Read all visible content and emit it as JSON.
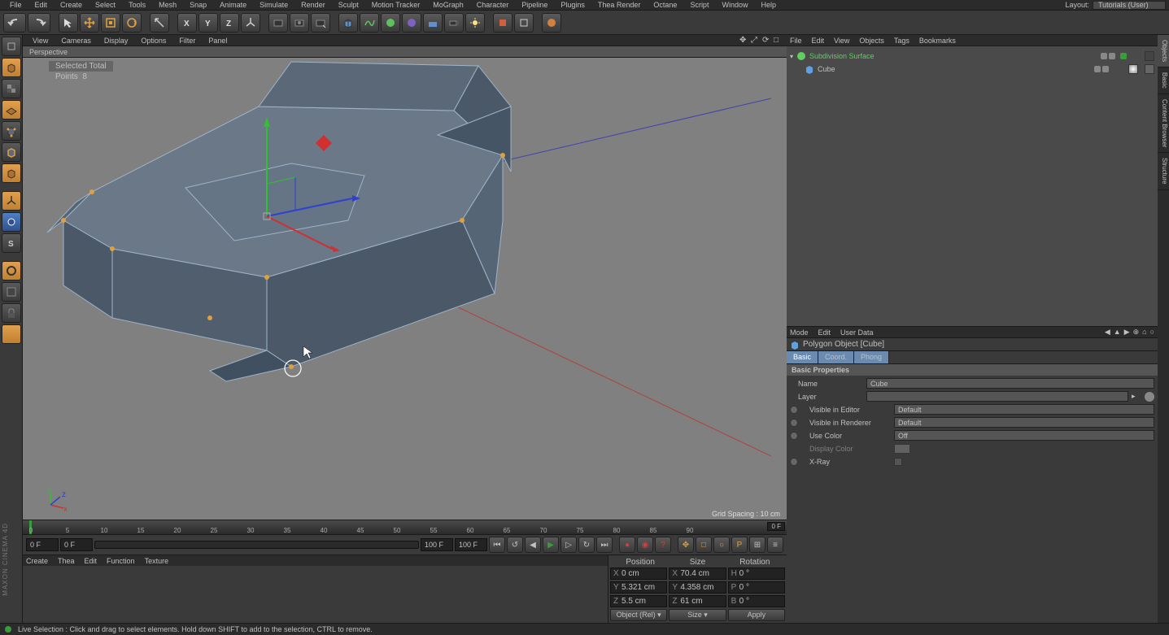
{
  "menubar": {
    "items": [
      "File",
      "Edit",
      "Create",
      "Select",
      "Tools",
      "Mesh",
      "Snap",
      "Animate",
      "Simulate",
      "Render",
      "Sculpt",
      "Motion Tracker",
      "MoGraph",
      "Character",
      "Pipeline",
      "Plugins",
      "Thea Render",
      "Octane",
      "Script",
      "Window",
      "Help"
    ],
    "layout_label": "Layout:",
    "layout_value": "Tutorials (User)"
  },
  "viewport_menu": {
    "items": [
      "View",
      "Cameras",
      "Display",
      "Options",
      "Filter",
      "Panel"
    ]
  },
  "viewport": {
    "tab": "Perspective",
    "selected_label": "Selected Total",
    "points_label": "Points",
    "points_value": "8",
    "grid_spacing": "Grid Spacing : 10 cm"
  },
  "timeline": {
    "ticks": [
      "0",
      "5",
      "10",
      "15",
      "20",
      "25",
      "30",
      "35",
      "40",
      "45",
      "50",
      "55",
      "60",
      "65",
      "70",
      "75",
      "80",
      "85",
      "90"
    ],
    "start_frame": "0 F",
    "range_start": "0 F",
    "range_end": "100 F",
    "end_frame": "100 F",
    "ruler_end": "0 F"
  },
  "cmd_bar": {
    "items": [
      "Create",
      "Thea",
      "Edit",
      "Function",
      "Texture"
    ]
  },
  "coords": {
    "headers": [
      "Position",
      "Size",
      "Rotation"
    ],
    "rows": [
      {
        "axis": "X",
        "pos": "0 cm",
        "sizeAxis": "X",
        "size": "70.4 cm",
        "rotAxis": "H",
        "rot": "0 °"
      },
      {
        "axis": "Y",
        "pos": "5.321 cm",
        "sizeAxis": "Y",
        "size": "4.358 cm",
        "rotAxis": "P",
        "rot": "0 °"
      },
      {
        "axis": "Z",
        "pos": "5.5 cm",
        "sizeAxis": "Z",
        "size": "61 cm",
        "rotAxis": "B",
        "rot": "0 °"
      }
    ],
    "mode_dropdown": "Object (Rel) ▾",
    "size_dropdown": "Size ▾",
    "apply": "Apply"
  },
  "obj_panel": {
    "menu": [
      "File",
      "Edit",
      "View",
      "Objects",
      "Tags",
      "Bookmarks"
    ],
    "tree": [
      {
        "name": "Subdivision Surface",
        "color": "#5fcf5f"
      },
      {
        "name": "Cube",
        "color": "#5fa0e0"
      }
    ]
  },
  "attr_panel": {
    "menu": [
      "Mode",
      "Edit",
      "User Data"
    ],
    "object_label": "Polygon Object [Cube]",
    "tabs": [
      "Basic",
      "Coord.",
      "Phong"
    ],
    "section": "Basic Properties",
    "rows": {
      "name_label": "Name",
      "name_value": "Cube",
      "layer_label": "Layer",
      "vis_editor_label": "Visible in Editor",
      "vis_editor_value": "Default",
      "vis_renderer_label": "Visible in Renderer",
      "vis_renderer_value": "Default",
      "use_color_label": "Use Color",
      "use_color_value": "Off",
      "display_color_label": "Display Color",
      "xray_label": "X-Ray"
    }
  },
  "right_tabs": [
    "Objects",
    "Basic",
    "Content Browser",
    "Structure"
  ],
  "status": "Live Selection : Click and drag to select elements. Hold down SHIFT to add to the selection, CTRL to remove.",
  "brand": "MAXON CINEMA 4D"
}
